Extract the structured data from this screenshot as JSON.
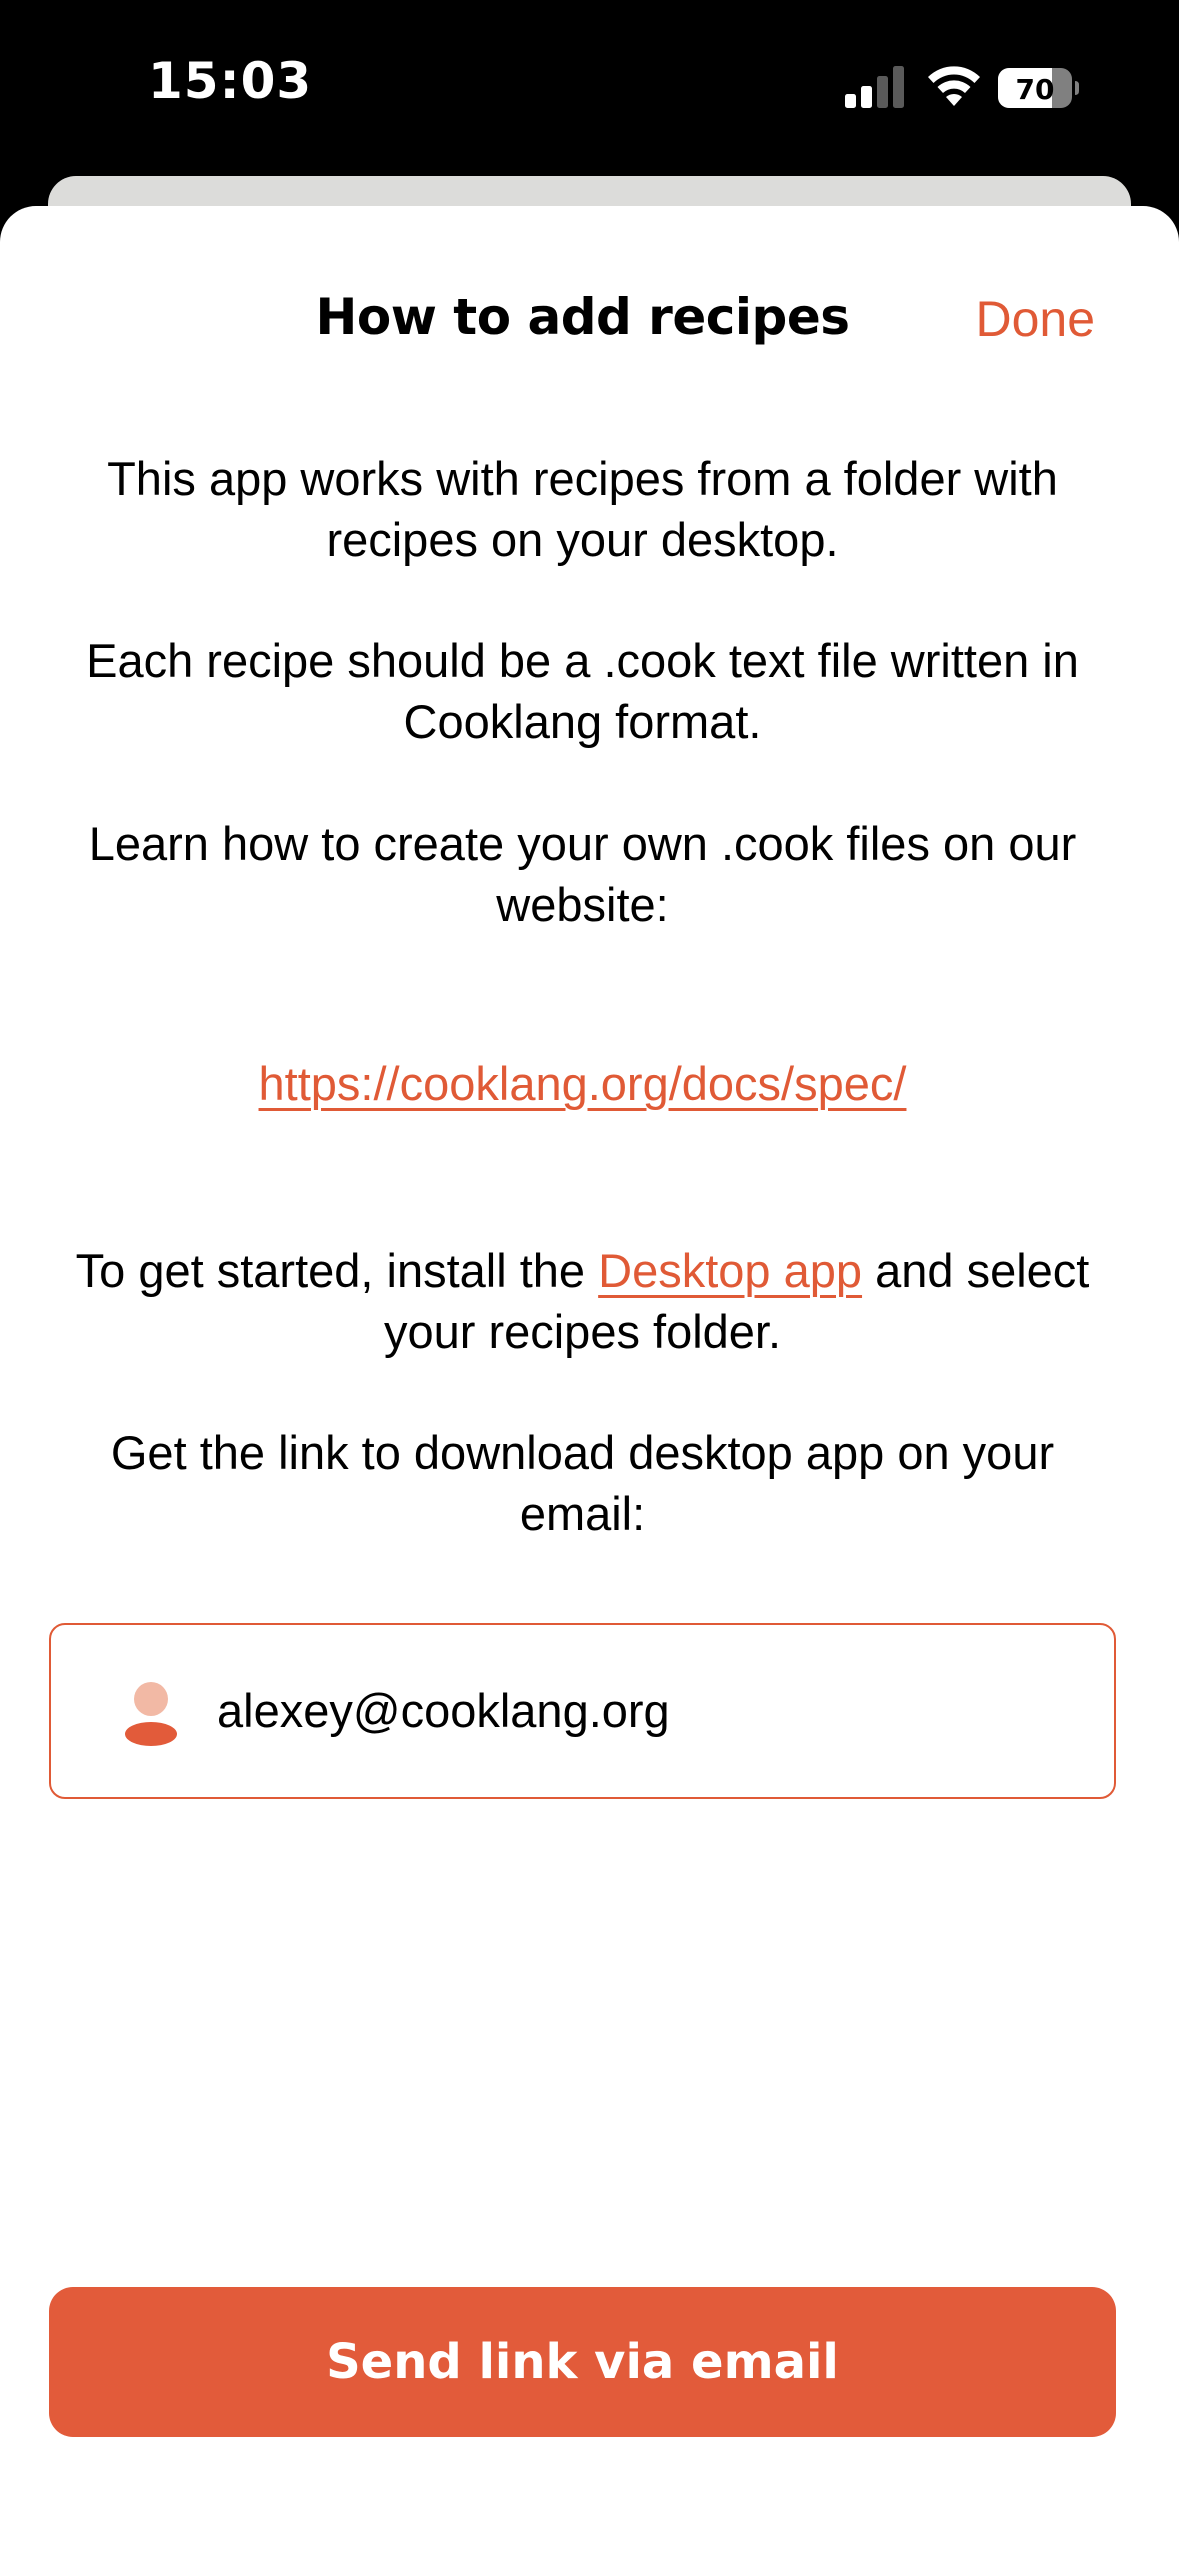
{
  "status_bar": {
    "time": "15:03",
    "battery_level": "70"
  },
  "sheet": {
    "title": "How to add recipes",
    "done_label": "Done",
    "paragraph1": "This app works with recipes from a folder with recipes on your desktop.",
    "paragraph2": "Each recipe should be a .cook text file written in Cooklang format.",
    "paragraph3": "Learn how to create your own .cook files on our website:",
    "spec_link": "https://cooklang.org/docs/spec/",
    "paragraph4_before": "To get started, install the ",
    "paragraph4_link": "Desktop app",
    "paragraph4_after": " and select your recipes folder.",
    "paragraph5": "Get the link to download desktop app on your email:"
  },
  "email_field": {
    "value": "alexey@cooklang.org",
    "icon": "person-icon"
  },
  "send_button": {
    "label": "Send link via email"
  },
  "colors": {
    "accent": "#e05a36",
    "button": "#e25b3a",
    "background": "#ffffff"
  }
}
